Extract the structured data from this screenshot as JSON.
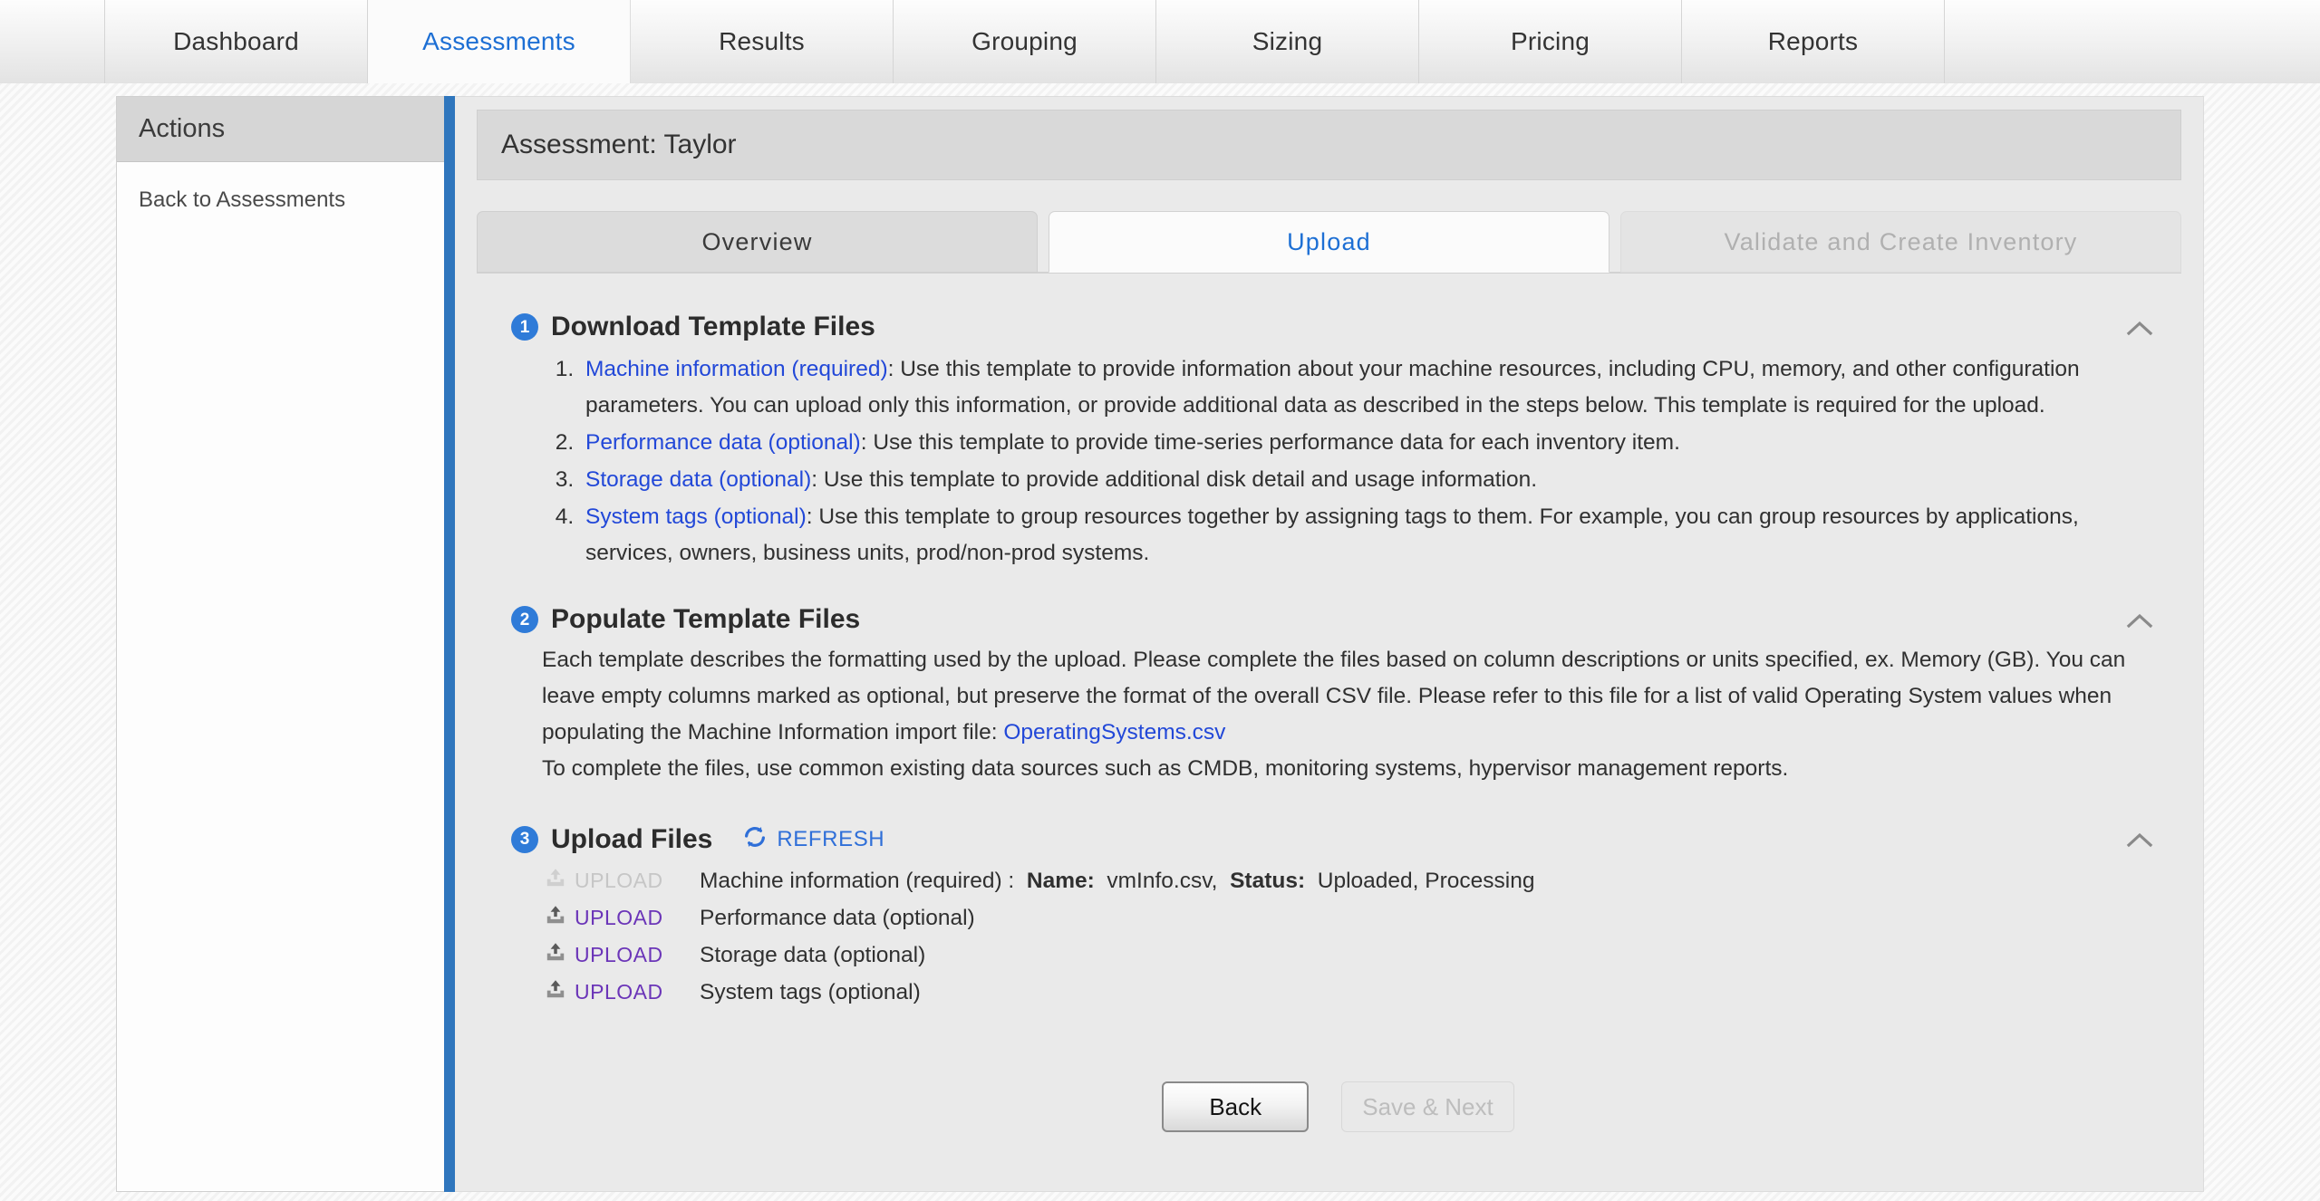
{
  "topnav": {
    "tabs": [
      {
        "label": "Dashboard",
        "active": false
      },
      {
        "label": "Assessments",
        "active": true
      },
      {
        "label": "Results",
        "active": false
      },
      {
        "label": "Grouping",
        "active": false
      },
      {
        "label": "Sizing",
        "active": false
      },
      {
        "label": "Pricing",
        "active": false
      },
      {
        "label": "Reports",
        "active": false
      }
    ]
  },
  "sidebar": {
    "header": "Actions",
    "items": [
      {
        "label": "Back to Assessments"
      }
    ]
  },
  "main": {
    "assessment_title": "Assessment: Taylor",
    "subtabs": [
      {
        "label": "Overview",
        "state": "inactive"
      },
      {
        "label": "Upload",
        "state": "active"
      },
      {
        "label": "Validate and Create Inventory",
        "state": "disabled"
      }
    ]
  },
  "section1": {
    "number": "1",
    "title": "Download Template Files",
    "collapse_icon": "chevron-up-icon",
    "items": [
      {
        "link": "Machine information (required)",
        "text": ": Use this template to provide information about your machine resources, including CPU, memory, and other configuration parameters. You can upload only this information, or provide additional data as described in the steps below. This template is required for the upload."
      },
      {
        "link": "Performance data (optional)",
        "text": ": Use this template to provide time-series performance data for each inventory item."
      },
      {
        "link": "Storage data (optional)",
        "text": ": Use this template to provide additional disk detail and usage information."
      },
      {
        "link": "System tags (optional)",
        "text": ": Use this template to group resources together by assigning tags to them. For example, you can group resources by applications, services, owners, business units, prod/non-prod systems."
      }
    ]
  },
  "section2": {
    "number": "2",
    "title": "Populate Template Files",
    "collapse_icon": "chevron-up-icon",
    "para1_before": "Each template describes the formatting used by the upload. Please complete the files based on column descriptions or units specified, ex. Memory (GB). You can leave empty columns marked as optional, but preserve the format of the overall CSV file. Please refer to this file for a list of valid Operating System values when populating the Machine Information import file: ",
    "para1_link": "OperatingSystems.csv",
    "para2": "To complete the files, use common existing data sources such as CMDB, monitoring systems, hypervisor management reports."
  },
  "section3": {
    "number": "3",
    "title": "Upload Files",
    "collapse_icon": "chevron-up-icon",
    "refresh_label": "REFRESH",
    "refresh_icon": "refresh-icon",
    "rows": [
      {
        "upload_label": "UPLOAD",
        "disabled": true,
        "name": "Machine information (required) :",
        "name_label": "Name:",
        "name_value": "vmInfo.csv,",
        "status_label": "Status:",
        "status_value": "Uploaded, Processing"
      },
      {
        "upload_label": "UPLOAD",
        "disabled": false,
        "name": "Performance data (optional)",
        "name_label": "",
        "name_value": "",
        "status_label": "",
        "status_value": ""
      },
      {
        "upload_label": "UPLOAD",
        "disabled": false,
        "name": "Storage data (optional)",
        "name_label": "",
        "name_value": "",
        "status_label": "",
        "status_value": ""
      },
      {
        "upload_label": "UPLOAD",
        "disabled": false,
        "name": "System tags (optional)",
        "name_label": "",
        "name_value": "",
        "status_label": "",
        "status_value": ""
      }
    ]
  },
  "footer": {
    "back_label": "Back",
    "save_next_label": "Save & Next"
  },
  "colors": {
    "accent_blue": "#2f76bd",
    "link_blue": "#2248d8",
    "tab_active_blue": "#1d6fd4",
    "upload_purple": "#6b35b8",
    "step_badge": "#2f7bd8"
  }
}
